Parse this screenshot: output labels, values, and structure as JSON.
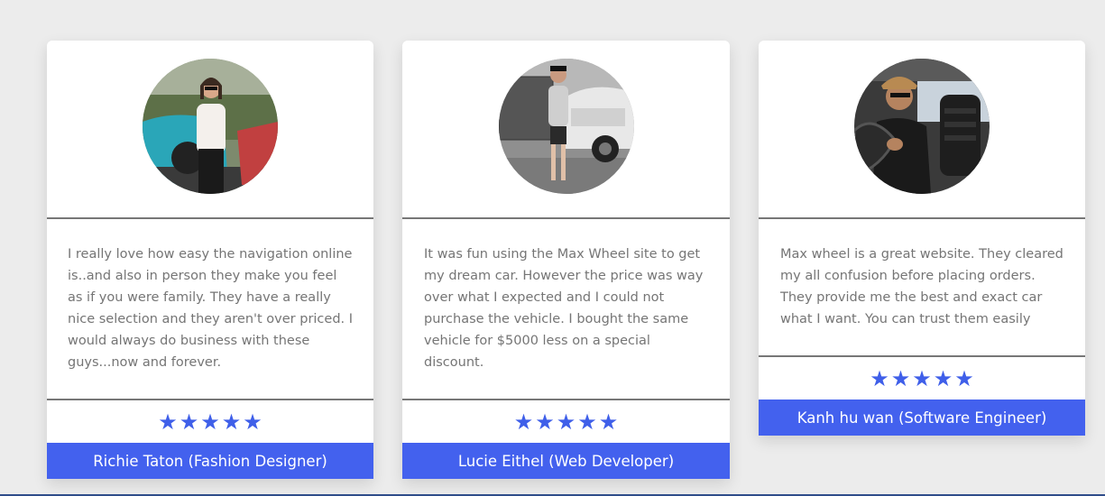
{
  "testimonials": [
    {
      "quote": "I really love how easy the navigation online is..and also in person they make you feel as if you were family. They have a really nice selection and they aren't over priced. I would always do business with these guys...now and forever.",
      "name": "Richie Taton (Fashion Designer)",
      "rating": 5
    },
    {
      "quote": "It was fun using the Max Wheel site to get my dream car. However the price was way over what I expected and I could not purchase the vehicle. I bought the same vehicle for $5000 less on a special discount.",
      "name": "Lucie Eithel (Web Developer)",
      "rating": 5
    },
    {
      "quote": "Max wheel is a great website. They cleared my all confusion before placing orders. They provide me the best and exact car what I want. You can trust them easily",
      "name": "Kanh hu wan (Software Engineer)",
      "rating": 5
    }
  ],
  "star_glyph": "★",
  "colors": {
    "accent": "#4361ee",
    "star": "#3f5fe9",
    "text": "#757575",
    "background": "#ececec"
  }
}
